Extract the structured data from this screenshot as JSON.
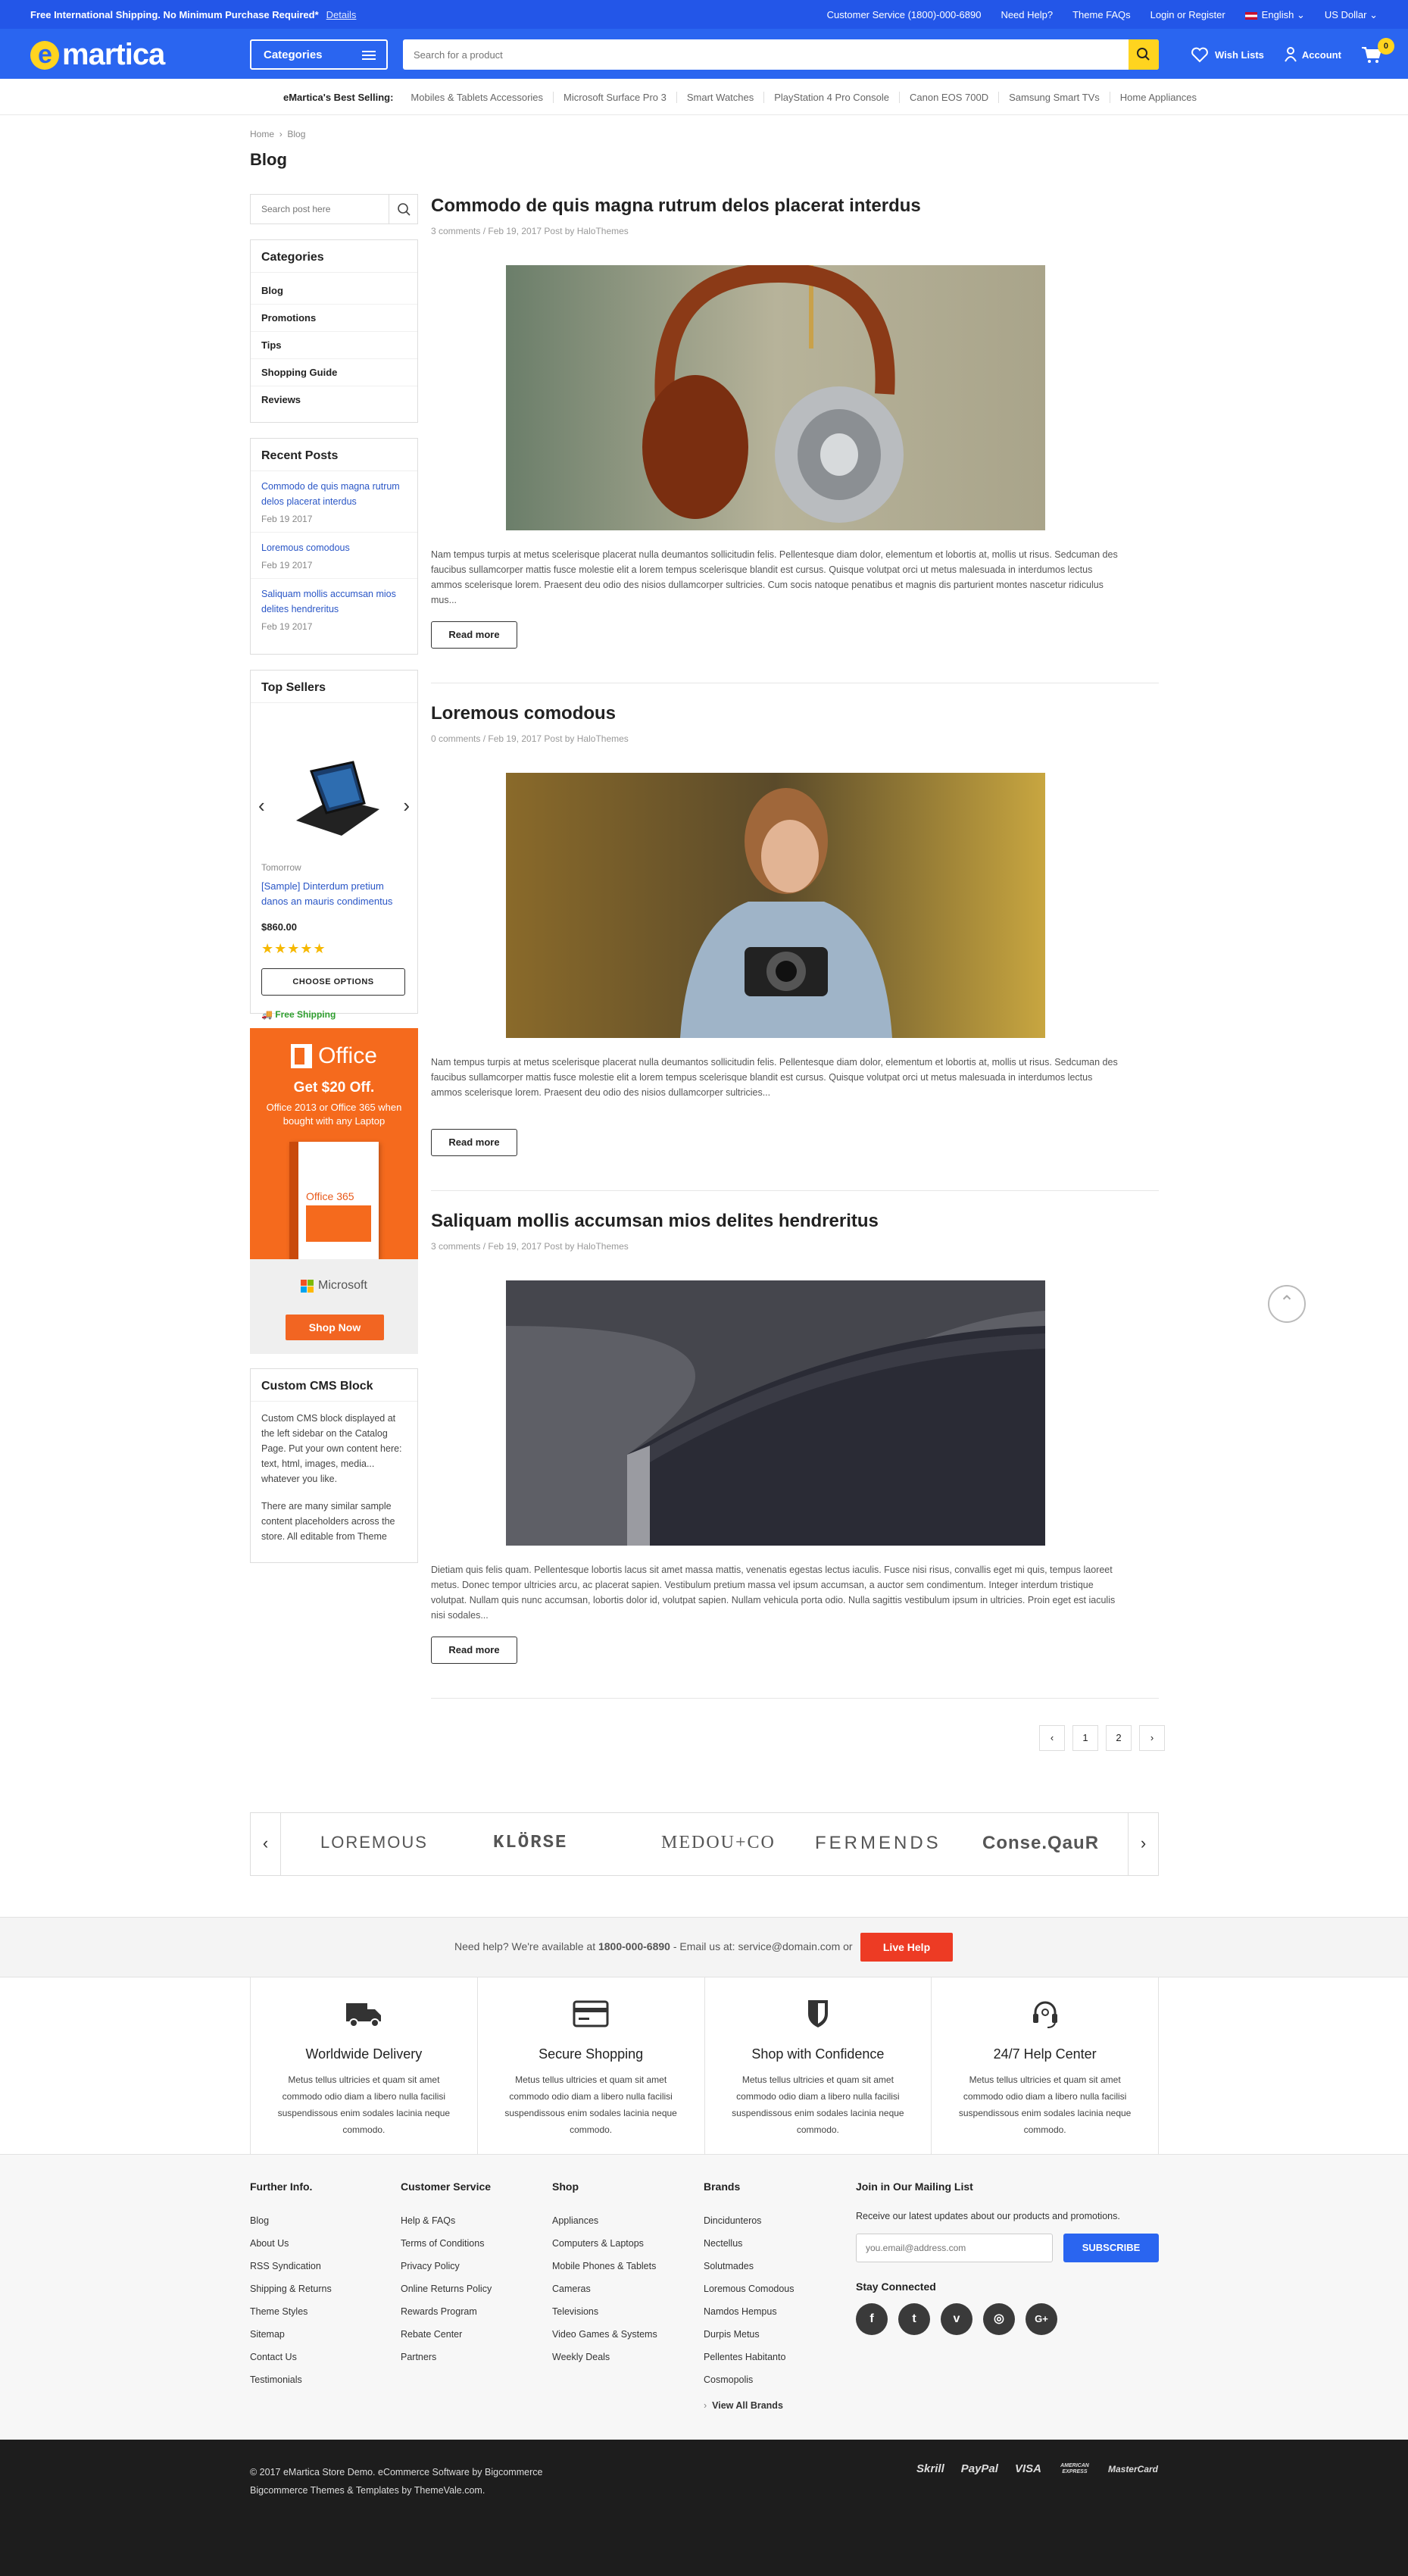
{
  "topbar": {
    "promo": "Free International Shipping. No Minimum Purchase Required*",
    "details": "Details",
    "customer_service": "Customer Service (1800)-000-6890",
    "need_help": "Need Help?",
    "theme_faqs": "Theme FAQs",
    "login": "Login or Register",
    "language": "English",
    "currency": "US Dollar"
  },
  "header": {
    "logo_letter": "e",
    "logo_text": "martica",
    "categories": "Categories",
    "search_placeholder": "Search for a product",
    "wishlists": "Wish Lists",
    "account": "Account",
    "cart_count": "0"
  },
  "best_selling": {
    "label": "eMartica's Best Selling:",
    "items": [
      "Mobiles & Tablets Accessories",
      "Microsoft Surface Pro 3",
      "Smart Watches",
      "PlayStation 4 Pro Console",
      "Canon EOS 700D",
      "Samsung Smart TVs",
      "Home Appliances"
    ]
  },
  "breadcrumb": {
    "home": "Home",
    "current": "Blog"
  },
  "page_title": "Blog",
  "sidebar": {
    "search_placeholder": "Search post here",
    "categories_title": "Categories",
    "categories": [
      "Blog",
      "Promotions",
      "Tips",
      "Shopping Guide",
      "Reviews"
    ],
    "recent_title": "Recent Posts",
    "recent": [
      {
        "title": "Commodo de quis magna rutrum delos placerat interdus",
        "date": "Feb 19 2017"
      },
      {
        "title": "Loremous comodous",
        "date": "Feb 19 2017"
      },
      {
        "title": "Saliquam mollis accumsan mios delites hendreritus",
        "date": "Feb 19 2017"
      }
    ],
    "top_sellers_title": "Top Sellers",
    "product": {
      "brand": "Tomorrow",
      "name": "[Sample] Dinterdum pretium danos an mauris condimentus",
      "price": "$860.00",
      "stars": "★★★★★",
      "button": "CHOOSE OPTIONS",
      "shipping": "Free Shipping"
    },
    "office_ad": {
      "brand": "Office",
      "headline": "Get $20 Off.",
      "subtext": "Office 2013 or Office 365 when bought with any Laptop",
      "box_label": "Office 365",
      "maker": "Microsoft",
      "button": "Shop Now"
    },
    "cms_title": "Custom CMS Block",
    "cms_p1": "Custom CMS block displayed at the left sidebar on the Catalog Page. Put your own content here: text, html, images, media... whatever you like.",
    "cms_p2": "There are many similar sample content placeholders across the store. All editable from Theme"
  },
  "posts": [
    {
      "title": "Commodo de quis magna rutrum delos placerat interdus",
      "meta": "3 comments / Feb 19, 2017 Post by HaloThemes",
      "image": "headphones",
      "excerpt": "Nam tempus turpis at metus scelerisque placerat nulla deumantos sollicitudin felis. Pellentesque diam dolor, elementum et lobortis at, mollis ut risus. Sedcuman des faucibus sullamcorper mattis fusce molestie elit a lorem tempus scelerisque blandit est cursus. Quisque volutpat orci ut metus malesuada in interdumos lectus ammos scelerisque lorem. Praesent deu odio des nisios dullamcorper sultricies. Cum socis natoque penatibus et magnis dis parturient montes nascetur ridiculus mus...",
      "read_more": "Read more"
    },
    {
      "title": "Loremous comodous",
      "meta": "0 comments / Feb 19, 2017 Post by HaloThemes",
      "image": "photographer",
      "excerpt": "Nam tempus turpis at metus scelerisque placerat nulla deumantos sollicitudin felis. Pellentesque diam dolor, elementum et lobortis at, mollis ut risus. Sedcuman des faucibus sullamcorper mattis fusce molestie elit a lorem tempus scelerisque blandit est cursus. Quisque volutpat orci ut metus malesuada in interdumos lectus ammos scelerisque lorem. Praesent deu odio des nisios dullamcorper sultricies...",
      "read_more": "Read more"
    },
    {
      "title": "Saliquam mollis accumsan mios delites hendreritus",
      "meta": "3 comments / Feb 19, 2017 Post by HaloThemes",
      "image": "monitor",
      "excerpt": "Dietiam quis felis quam. Pellentesque lobortis lacus sit amet massa mattis, venenatis egestas lectus iaculis. Fusce nisi risus, convallis eget mi quis, tempus laoreet metus. Donec tempor ultricies arcu, ac placerat sapien. Vestibulum pretium massa vel ipsum accumsan, a auctor sem condimentum. Integer interdum tristique volutpat. Nullam quis nunc accumsan, lobortis dolor id, volutpat sapien. Nullam vehicula porta odio. Nulla sagittis vestibulum ipsum in ultricies. Proin eget est iaculis nisi sodales...",
      "read_more": "Read more"
    }
  ],
  "pagination": {
    "prev": "‹",
    "pages": [
      "1",
      "2"
    ],
    "next": "›"
  },
  "brands": [
    "LOREMOUS",
    "KLÖRSE",
    "MEDOU+CO",
    "FERMENDS",
    "Conse.QauR"
  ],
  "help": {
    "text_before": "Need help? We're available at ",
    "phone": "1800-000-6890",
    "text_after": " - Email us at: service@domain.com or",
    "button": "Live Help"
  },
  "features": [
    {
      "icon": "truck-icon",
      "title": "Worldwide Delivery",
      "text": "Metus tellus ultricies et quam sit amet commodo odio diam a libero nulla facilisi suspendissous enim sodales lacinia neque commodo."
    },
    {
      "icon": "credit-card-icon",
      "title": "Secure Shopping",
      "text": "Metus tellus ultricies et quam sit amet commodo odio diam a libero nulla facilisi suspendissous enim sodales lacinia neque commodo."
    },
    {
      "icon": "shield-icon",
      "title": "Shop with Confidence",
      "text": "Metus tellus ultricies et quam sit amet commodo odio diam a libero nulla facilisi suspendissous enim sodales lacinia neque commodo."
    },
    {
      "icon": "headset-icon",
      "title": "24/7 Help Center",
      "text": "Metus tellus ultricies et quam sit amet commodo odio diam a libero nulla facilisi suspendissous enim sodales lacinia neque commodo."
    }
  ],
  "footer": {
    "further": {
      "title": "Further Info.",
      "links": [
        "Blog",
        "About Us",
        "RSS Syndication",
        "Shipping & Returns",
        "Theme Styles",
        "Sitemap",
        "Contact Us",
        "Testimonials"
      ]
    },
    "service": {
      "title": "Customer Service",
      "links": [
        "Help & FAQs",
        "Terms of Conditions",
        "Privacy Policy",
        "Online Returns Policy",
        "Rewards Program",
        "Rebate Center",
        "Partners"
      ]
    },
    "shop": {
      "title": "Shop",
      "links": [
        "Appliances",
        "Computers & Laptops",
        "Mobile Phones & Tablets",
        "Cameras",
        "Televisions",
        "Video Games & Systems",
        "Weekly Deals"
      ]
    },
    "brands": {
      "title": "Brands",
      "links": [
        "Dincidunteros",
        "Nectellus",
        "Solutmades",
        "Loremous Comodous",
        "Namdos Hempus",
        "Durpis Metus",
        "Pellentes Habitanto",
        "Cosmopolis"
      ],
      "view_all": "View All Brands"
    },
    "newsletter": {
      "title": "Join in Our Mailing List",
      "text": "Receive our latest updates about our products and promotions.",
      "placeholder": "you.email@address.com",
      "button": "SUBSCRIBE",
      "stay": "Stay Connected",
      "social": [
        "f",
        "t",
        "v",
        "◎",
        "G+"
      ]
    }
  },
  "bottom": {
    "copyright": "© 2017 eMartica Store Demo. eCommerce Software by Bigcommerce",
    "credits": "Bigcommerce Themes & Templates by ThemeVale.com.",
    "payments": [
      "Skrill",
      "PayPal",
      "VISA",
      "AMERICAN EXPRESS",
      "MasterCard"
    ]
  },
  "colors": {
    "topbar": "#2356e8",
    "header": "#2a65f0",
    "accent_yellow": "#ffd41f",
    "office_orange": "#f56a1d",
    "live_help": "#ed3b24"
  }
}
